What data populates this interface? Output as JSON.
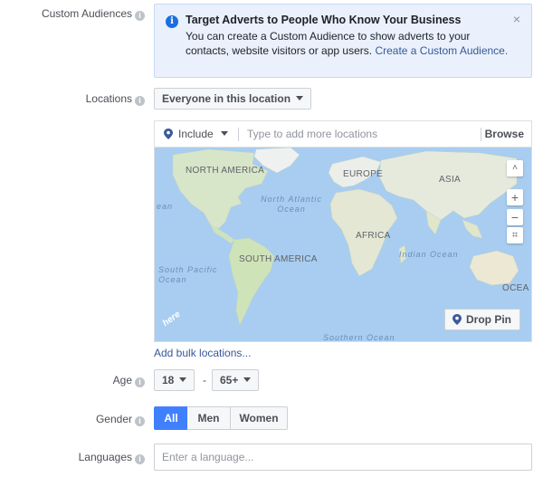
{
  "custom_audiences": {
    "label": "Custom Audiences",
    "notice_title": "Target Adverts to People Who Know Your Business",
    "notice_body": "You can create a Custom Audience to show adverts to your contacts, website visitors or app users.",
    "notice_link": "Create a Custom Audience."
  },
  "locations": {
    "label": "Locations",
    "scope": "Everyone in this location",
    "include": "Include",
    "search_placeholder": "Type to add more locations",
    "browse": "Browse",
    "drop_pin": "Drop Pin",
    "bulk_link": "Add bulk locations...",
    "map_labels": [
      "NORTH AMERICA",
      "EUROPE",
      "ASIA",
      "AFRICA",
      "SOUTH AMERICA",
      "OCEA"
    ],
    "ocean_labels": [
      "North Atlantic Ocean",
      "Indian Ocean",
      "South Pacific Ocean",
      "ean",
      "Southern Ocean"
    ],
    "map_attribution": "here"
  },
  "age": {
    "label": "Age",
    "min": "18",
    "separator": "-",
    "max": "65+"
  },
  "gender": {
    "label": "Gender",
    "options": [
      "All",
      "Men",
      "Women"
    ],
    "selected": "All"
  },
  "languages": {
    "label": "Languages",
    "placeholder": "Enter a language..."
  },
  "colors": {
    "accent": "#4080ff",
    "link": "#365899",
    "notice_bg": "#eaf1fc",
    "ocean": "#a8cdf0"
  },
  "icons": [
    "info-icon",
    "close-icon",
    "pin-icon",
    "chevron-down-icon",
    "zoom-in-icon",
    "zoom-out-icon",
    "fullscreen-icon"
  ]
}
